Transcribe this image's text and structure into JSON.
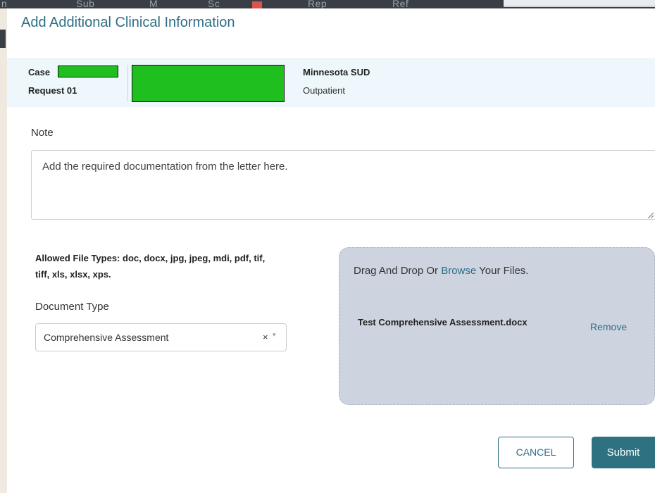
{
  "background": {
    "tabs": [
      "n",
      "Sub",
      "M",
      "Sc",
      "Rep",
      "Ref"
    ]
  },
  "modal": {
    "title": "Add Additional Clinical Information",
    "case": {
      "case_label": "Case",
      "request_label": "Request 01",
      "program_name": "Minnesota SUD",
      "program_type": "Outpatient"
    },
    "note": {
      "label": "Note",
      "value": "Add the required documentation from the letter here."
    },
    "allowed_file_types": "Allowed File Types: doc, docx, jpg, jpeg, mdi, pdf, tif, tiff, xls, xlsx, xps.",
    "document_type": {
      "label": "Document Type",
      "selected": "Comprehensive Assessment",
      "clear_glyph": "×",
      "caret_glyph": "▾"
    },
    "dropzone": {
      "text_before": "Drag And Drop Or ",
      "browse_link": "Browse",
      "text_after": " Your Files.",
      "file_name": "Test Comprehensive Assessment.docx",
      "remove_label": "Remove"
    },
    "buttons": {
      "cancel": "CANCEL",
      "submit": "Submit"
    }
  },
  "colors": {
    "accent": "#2e6e86",
    "redaction": "#1fbf1f",
    "dropzone_bg": "#cdd4e0",
    "case_strip_bg": "#eef7fb"
  }
}
